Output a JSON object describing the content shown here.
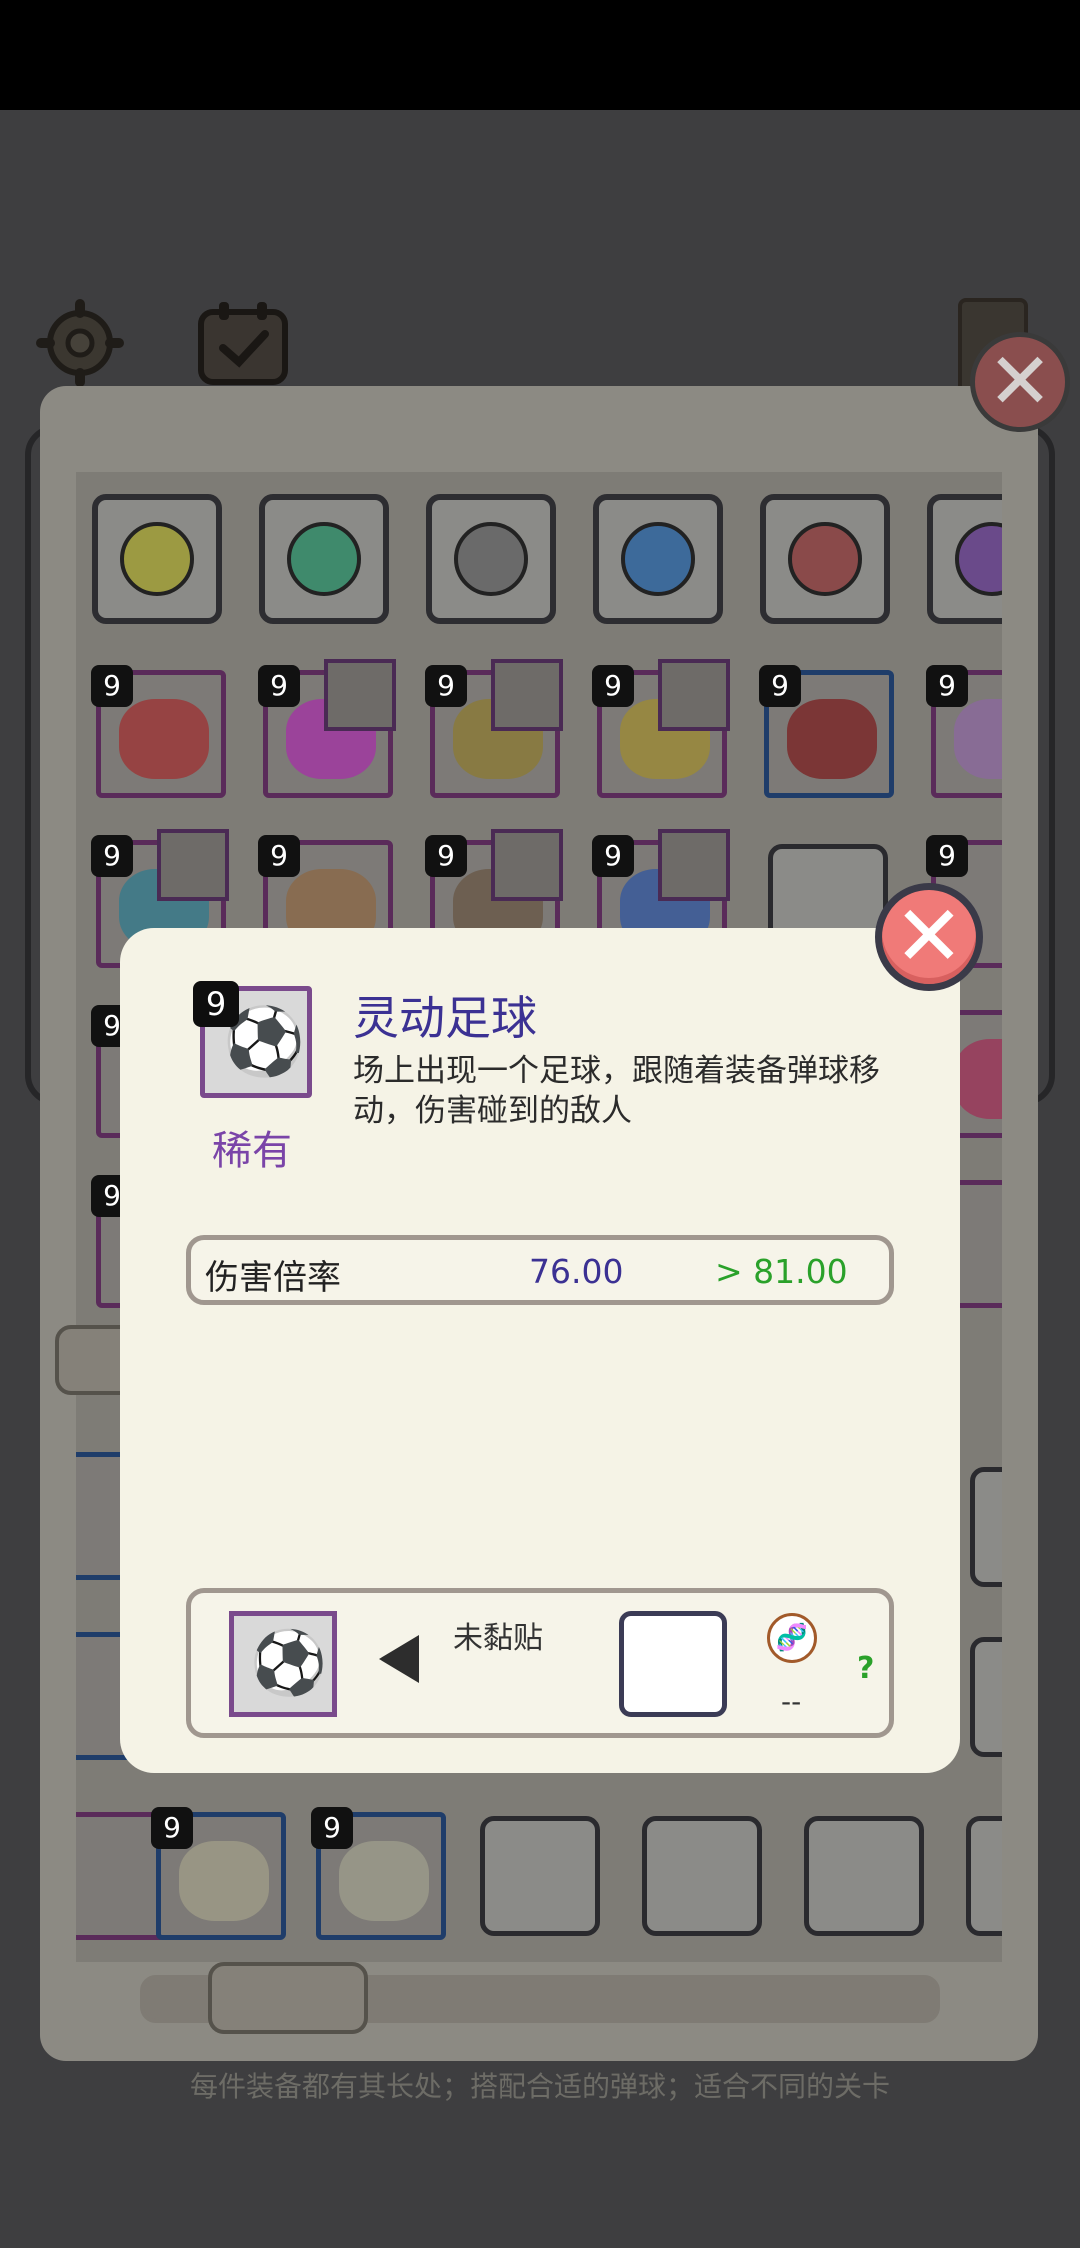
{
  "dialog": {
    "item": {
      "level": "9",
      "icon": "soccer-ball-icon",
      "name": "灵动足球",
      "rarity": "稀有",
      "description": "场上出现一个足球，跟随着装备弹球移动，伤害碰到的敌人"
    },
    "stats": [
      {
        "label": "伤害倍率",
        "current": "76.00",
        "next": "> 81.00"
      }
    ],
    "sticker": {
      "status": "未黏贴",
      "dna_icon": "dna-icon",
      "dna_value": "--",
      "help": "?"
    },
    "close": "✕"
  },
  "background": {
    "level_badges": [
      "9",
      "9",
      "9",
      "9",
      "9",
      "9",
      "9",
      "9",
      "9",
      "9",
      "9",
      "9",
      "9",
      "9",
      "9"
    ],
    "hint": "每件装备都有其长处；搭配合适的弹球；适合不同的关卡",
    "close": "✕"
  },
  "colors": {
    "dialog_bg": "#f5f3e6",
    "title": "#3b3193",
    "rarity": "#7a44a8",
    "next_value": "#2aa12a",
    "close_button": "#f07a78"
  }
}
